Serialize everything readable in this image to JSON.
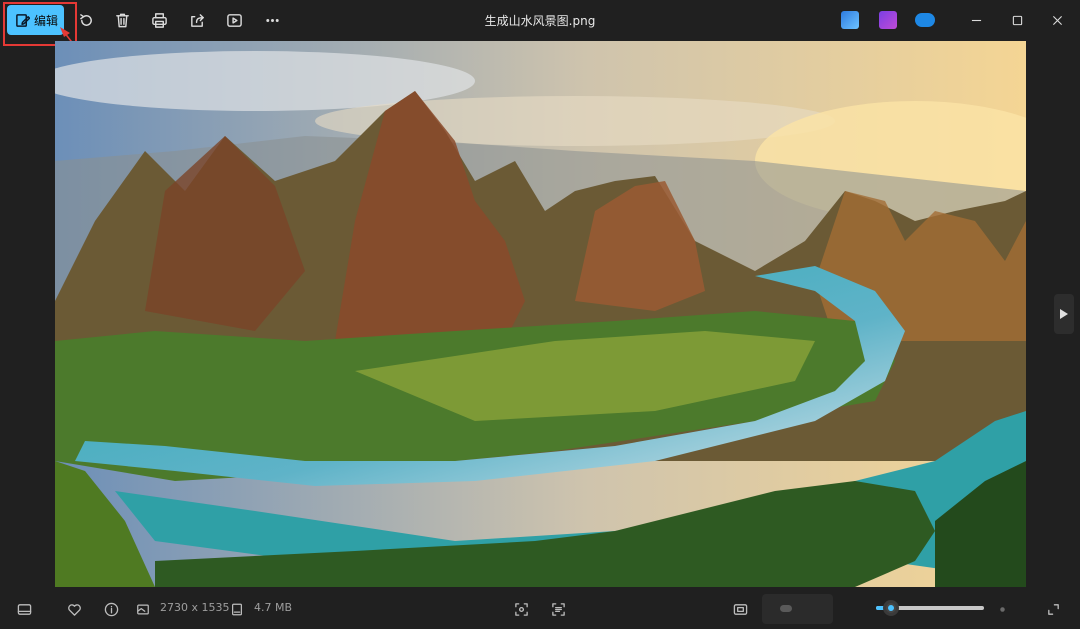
{
  "toolbar": {
    "edit_label": "编辑",
    "icons": [
      "rotate-icon",
      "delete-icon",
      "print-icon",
      "share-icon",
      "slideshow-icon",
      "more-icon"
    ]
  },
  "window": {
    "title": "生成山水风景图.png"
  },
  "image": {
    "description_icon": "landscape-photo"
  },
  "bottom": {
    "dimensions": "2730 x 1535",
    "file_size": "4.7 MB",
    "zoom_fraction": 0.1
  },
  "colors": {
    "accent": "#4cc2ff",
    "highlight": "#e53935"
  }
}
